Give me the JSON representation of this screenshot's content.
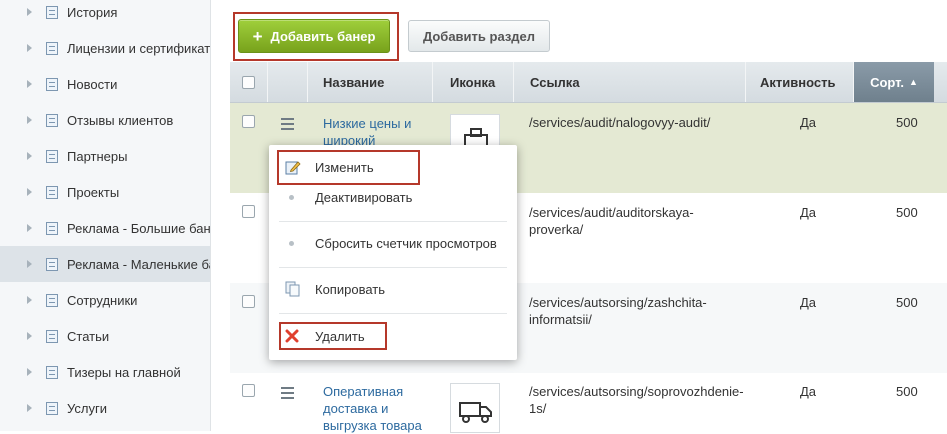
{
  "sidebar": {
    "items": [
      {
        "label": "История"
      },
      {
        "label": "Лицензии и сертификаты"
      },
      {
        "label": "Новости"
      },
      {
        "label": "Отзывы клиентов"
      },
      {
        "label": "Партнеры"
      },
      {
        "label": "Проекты"
      },
      {
        "label": "Реклама - Большие баннеры"
      },
      {
        "label": "Реклама - Маленькие баннеры"
      },
      {
        "label": "Сотрудники"
      },
      {
        "label": "Статьи"
      },
      {
        "label": "Тизеры на главной"
      },
      {
        "label": "Услуги"
      }
    ],
    "active_index": 7
  },
  "toolbar": {
    "add_banner_label": "Добавить банер",
    "add_section_label": "Добавить раздел"
  },
  "table": {
    "columns": {
      "name": "Название",
      "icon": "Иконка",
      "link": "Ссылка",
      "active": "Активность",
      "sort": "Сорт."
    },
    "sorted_column": "sort",
    "rows": [
      {
        "name": "Низкие цены и широкий",
        "link": "/services/audit/nalogovyy-audit/",
        "active": "Да",
        "sort": "500",
        "icon": "briefcase-icon"
      },
      {
        "name": "",
        "link": "/services/audit/auditorskaya-proverka/",
        "active": "Да",
        "sort": "500",
        "icon": ""
      },
      {
        "name": "",
        "link": "/services/autsorsing/zashchita-informatsii/",
        "active": "Да",
        "sort": "500",
        "icon": ""
      },
      {
        "name": "Оперативная доставка и выгрузка товара",
        "link": "/services/autsorsing/soprovozhdenie-1s/",
        "active": "Да",
        "sort": "500",
        "icon": "truck-icon"
      }
    ]
  },
  "context_menu": {
    "items": [
      {
        "label": "Изменить",
        "icon": "edit-icon"
      },
      {
        "label": "Деактивировать",
        "icon": "dot-icon"
      },
      {
        "label": "Сбросить счетчик просмотров",
        "icon": "dot-icon"
      },
      {
        "label": "Копировать",
        "icon": "copy-icon"
      },
      {
        "label": "Удалить",
        "icon": "delete-icon"
      }
    ]
  },
  "colors": {
    "primary_button": "#8dbb2a",
    "highlight_border": "#b5382a",
    "selected_row": "#e4e9d3",
    "link": "#2d6a9f",
    "sorted_header": "#7d8e9b"
  }
}
